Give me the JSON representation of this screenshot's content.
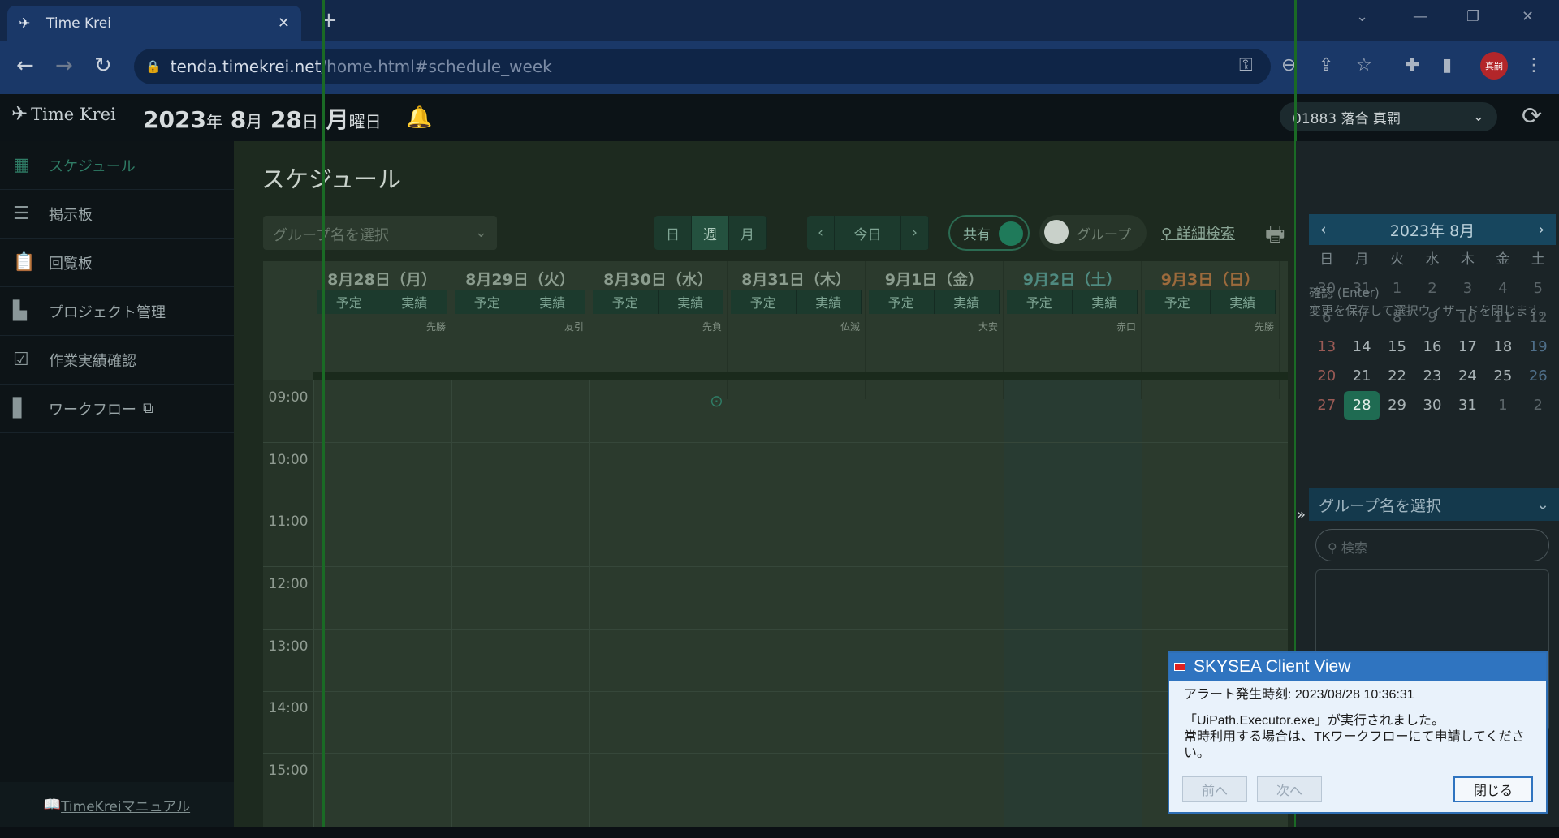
{
  "browser": {
    "tab_title": "Time Krei",
    "url_host": "tenda.timekrei.net",
    "url_path": "/home.html#schedule_week",
    "profile_label": "真嗣"
  },
  "header": {
    "logo_text": "Time Krei",
    "date_year": "2023",
    "nen": "年",
    "date_month": "8",
    "gatsu": "月",
    "date_day": "28",
    "nichi": "日",
    "weekday": "月",
    "youbi": "曜日",
    "user": "01883 落合 真嗣"
  },
  "sidebar": {
    "items": [
      {
        "label": "スケジュール"
      },
      {
        "label": "掲示板"
      },
      {
        "label": "回覧板"
      },
      {
        "label": "プロジェクト管理"
      },
      {
        "label": "作業実績確認"
      },
      {
        "label": "ワークフロー"
      }
    ],
    "manual": "TimeKreiマニュアル"
  },
  "main": {
    "title": "スケジュール",
    "group_placeholder": "グループ名を選択",
    "view_day": "日",
    "view_week": "週",
    "view_month": "月",
    "today": "今日",
    "toggle_shared": "共有",
    "toggle_group": "グループ",
    "detail_search": "詳細検索"
  },
  "days": [
    {
      "label": "8月28日（月）",
      "rokuyo": "先勝",
      "yotei": "予定",
      "jisseki": "実績"
    },
    {
      "label": "8月29日（火）",
      "rokuyo": "友引",
      "yotei": "予定",
      "jisseki": "実績"
    },
    {
      "label": "8月30日（水）",
      "rokuyo": "先負",
      "yotei": "予定",
      "jisseki": "実績"
    },
    {
      "label": "8月31日（木）",
      "rokuyo": "仏滅",
      "yotei": "予定",
      "jisseki": "実績"
    },
    {
      "label": "9月1日（金）",
      "rokuyo": "大安",
      "yotei": "予定",
      "jisseki": "実績"
    },
    {
      "label": "9月2日（土）",
      "rokuyo": "赤口",
      "yotei": "予定",
      "jisseki": "実績"
    },
    {
      "label": "9月3日（日）",
      "rokuyo": "先勝",
      "yotei": "予定",
      "jisseki": "実績"
    }
  ],
  "times": [
    "09:00",
    "10:00",
    "11:00",
    "12:00",
    "13:00",
    "14:00",
    "15:00"
  ],
  "minical": {
    "title": "2023年 8月",
    "weekdays": [
      "日",
      "月",
      "火",
      "水",
      "木",
      "金",
      "土"
    ],
    "rows": [
      [
        "30",
        "31",
        "1",
        "2",
        "3",
        "4",
        "5"
      ],
      [
        "6",
        "7",
        "8",
        "9",
        "10",
        "11",
        "12"
      ],
      [
        "13",
        "14",
        "15",
        "16",
        "17",
        "18",
        "19"
      ],
      [
        "20",
        "21",
        "22",
        "23",
        "24",
        "25",
        "26"
      ],
      [
        "27",
        "28",
        "29",
        "30",
        "31",
        "1",
        "2"
      ]
    ],
    "today": "28",
    "tip1": "確認 (Enter)",
    "tip2": "変更を保存して選択ウィザードを閉じます。"
  },
  "right": {
    "group_placeholder": "グループ名を選択",
    "search_placeholder": "検索"
  },
  "dialog": {
    "title": "SKYSEA Client View",
    "line1": "アラート発生時刻: 2023/08/28 10:36:31",
    "line2": "「UiPath.Executor.exe」が実行されました。",
    "line3": "常時利用する場合は、TKワークフローにて申請してください。",
    "prev": "前へ",
    "next": "次へ",
    "close": "閉じる"
  }
}
